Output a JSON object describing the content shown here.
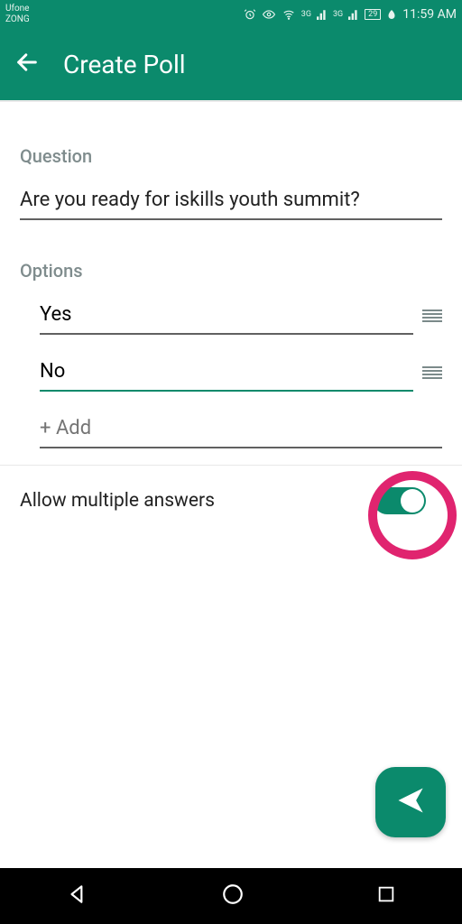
{
  "statusbar": {
    "carrier1": "Ufone",
    "carrier2": "ZONG",
    "net1": "3G",
    "net2": "3G",
    "battery": "29",
    "time": "11:59 AM"
  },
  "header": {
    "title": "Create Poll"
  },
  "poll": {
    "question_label": "Question",
    "question_value": "Are you ready for iskills youth summit?",
    "options_label": "Options",
    "options": [
      {
        "value": "Yes",
        "active": false
      },
      {
        "value": "No",
        "active": true
      }
    ],
    "add_placeholder": "+ Add",
    "allow_multiple_label": "Allow multiple answers",
    "allow_multiple_on": true
  },
  "icons": {
    "back": "back-arrow-icon",
    "alarm": "alarm-icon",
    "eye": "visibility-icon",
    "wifi": "wifi-icon",
    "signal": "signal-icon",
    "leaf": "battery-saver-icon",
    "drag": "drag-handle-icon",
    "send": "send-icon",
    "nav_back": "nav-back-icon",
    "nav_home": "nav-home-icon",
    "nav_recent": "nav-recent-icon"
  },
  "colors": {
    "primary": "#0b8a6c",
    "highlight": "#e0246f"
  }
}
